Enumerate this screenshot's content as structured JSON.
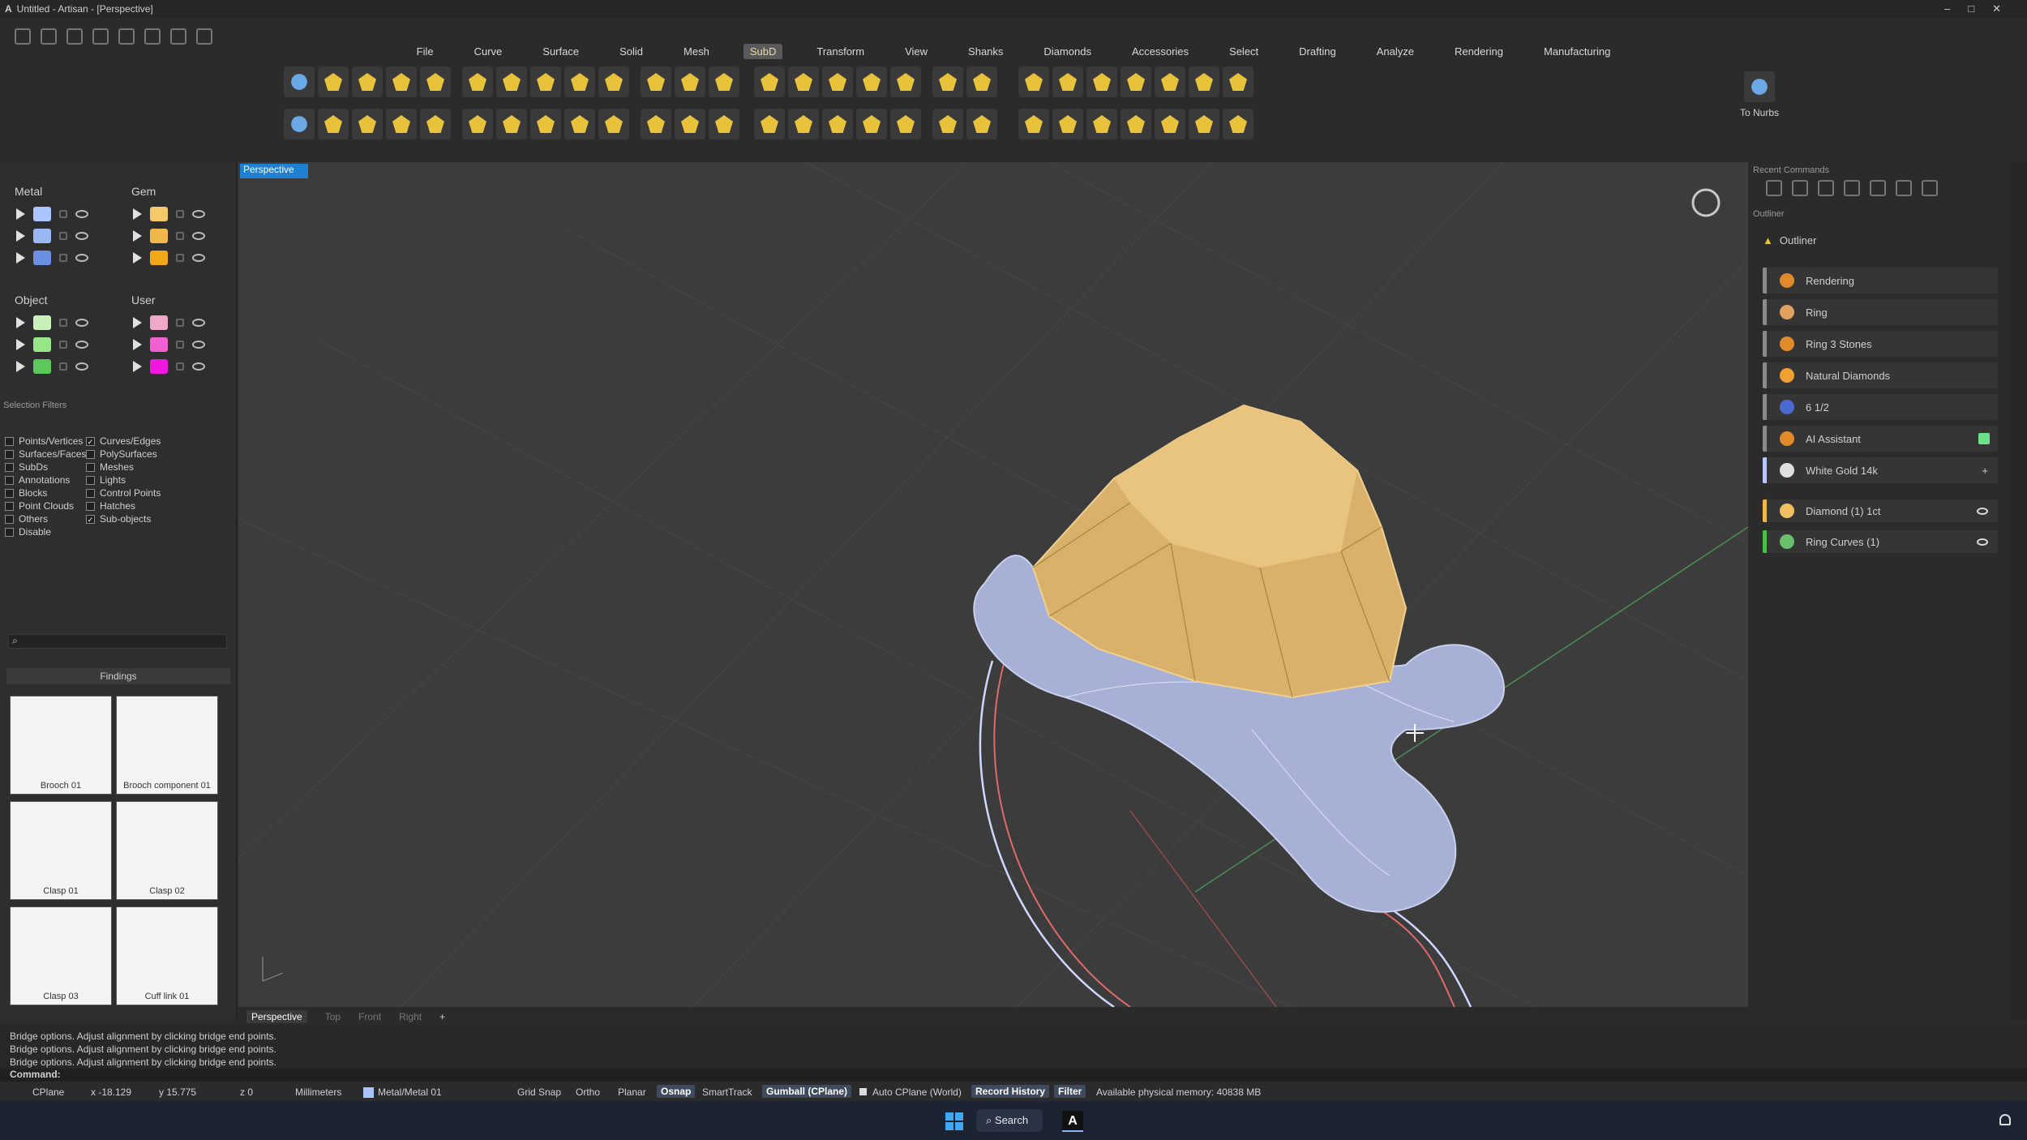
{
  "window": {
    "title": "Untitled - Artisan - [Perspective]"
  },
  "menu": [
    "File",
    "Curve",
    "Surface",
    "Solid",
    "Mesh",
    "SubD",
    "Transform",
    "View",
    "Shanks",
    "Diamonds",
    "Accessories",
    "Select",
    "Drafting",
    "Analyze",
    "Rendering",
    "Manufacturing"
  ],
  "menu_active": "SubD",
  "toolbar": {
    "to_nurbs": "To Nurbs"
  },
  "layers": {
    "metal": {
      "title": "Metal",
      "colors": [
        "#aac4ff",
        "#9ab8f4",
        "#6a8ee0"
      ]
    },
    "gem": {
      "title": "Gem",
      "colors": [
        "#f4c96a",
        "#f0b84a",
        "#f0a818"
      ]
    },
    "object": {
      "title": "Object",
      "colors": [
        "#c8f0b8",
        "#98e488",
        "#5cc85c"
      ]
    },
    "user": {
      "title": "User",
      "colors": [
        "#f0a8c8",
        "#f060d0",
        "#f018e0"
      ]
    }
  },
  "selection_filters": {
    "title": "Selection Filters",
    "left": [
      {
        "label": "Points/Vertices",
        "checked": false
      },
      {
        "label": "Surfaces/Faces",
        "checked": false
      },
      {
        "label": "SubDs",
        "checked": false
      },
      {
        "label": "Annotations",
        "checked": false
      },
      {
        "label": "Blocks",
        "checked": false
      },
      {
        "label": "Point Clouds",
        "checked": false
      },
      {
        "label": "Others",
        "checked": false
      },
      {
        "label": "Disable",
        "checked": false
      }
    ],
    "right": [
      {
        "label": "Curves/Edges",
        "checked": true
      },
      {
        "label": "PolySurfaces",
        "checked": false
      },
      {
        "label": "Meshes",
        "checked": false
      },
      {
        "label": "Lights",
        "checked": false
      },
      {
        "label": "Control Points",
        "checked": false
      },
      {
        "label": "Hatches",
        "checked": false
      },
      {
        "label": "Sub-objects",
        "checked": true
      }
    ]
  },
  "library": {
    "category": "Findings",
    "items": [
      "Brooch 01",
      "Brooch component 01",
      "Clasp 01",
      "Clasp 02",
      "Clasp 03",
      "Cuff link 01"
    ]
  },
  "viewport": {
    "active": "Perspective",
    "tabs": [
      "Perspective",
      "Top",
      "Front",
      "Right"
    ]
  },
  "right_panel": {
    "recent_commands": "Recent Commands",
    "outliner_label": "Outliner",
    "outliner_title": "Outliner",
    "items": [
      "Rendering",
      "Ring",
      "Ring 3 Stones",
      "Natural Diamonds",
      "6 1/2",
      "AI Assistant",
      "White Gold 14k"
    ],
    "objects": [
      "Diamond (1) 1ct",
      "Ring Curves (1)"
    ]
  },
  "command": {
    "history": [
      "Bridge options. Adjust alignment by clicking bridge end points.",
      "Bridge options. Adjust alignment by clicking bridge end points.",
      "Bridge options. Adjust alignment by clicking bridge end points."
    ],
    "prompt": "Command:"
  },
  "status": {
    "cplane": "CPlane",
    "x": "x -18.129",
    "y": "y 15.775",
    "z": "z 0",
    "units": "Millimeters",
    "layer": "Metal/Metal 01",
    "grid_snap": "Grid Snap",
    "ortho": "Ortho",
    "planar": "Planar",
    "osnap": "Osnap",
    "smarttrack": "SmartTrack",
    "gumball": "Gumball (CPlane)",
    "auto_cplane": "Auto CPlane (World)",
    "record_history": "Record History",
    "filter": "Filter",
    "memory": "Available physical memory: 40838 MB"
  },
  "taskbar": {
    "search": "Search"
  }
}
